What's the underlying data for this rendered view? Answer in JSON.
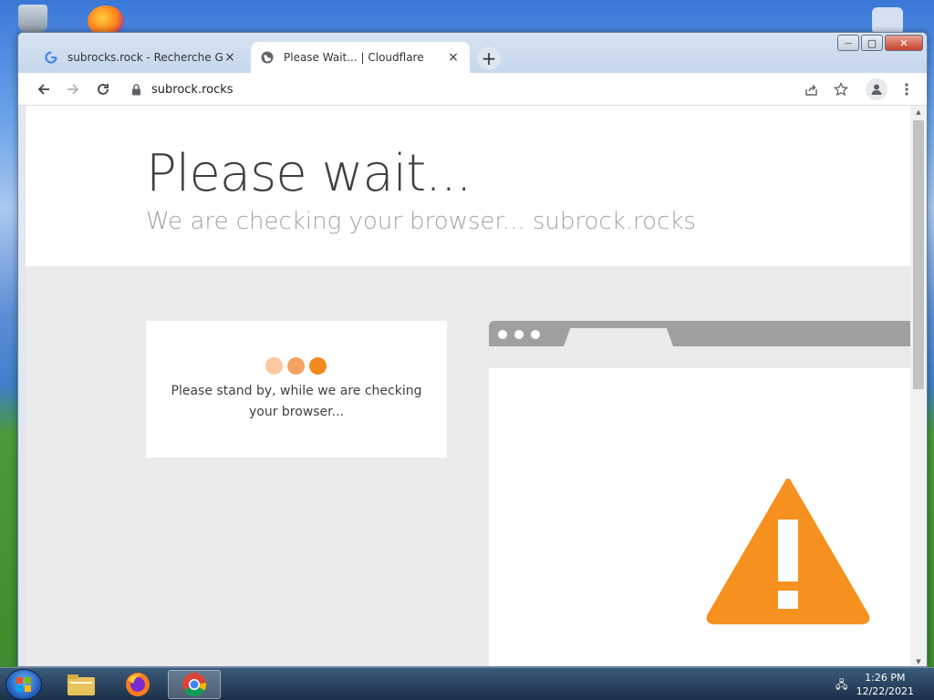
{
  "browser": {
    "tabs": [
      {
        "title": "subrocks.rock - Recherche Googl",
        "favicon": "google-icon",
        "close": "×"
      },
      {
        "title": "Please Wait... | Cloudflare",
        "favicon": "globe-icon",
        "close": "×"
      }
    ],
    "new_tab": "+",
    "address": "subrock.rocks",
    "window_controls": {
      "minimize": "—",
      "maximize": "▢",
      "close": "✕"
    }
  },
  "page": {
    "heading": "Please wait...",
    "subheading": "We are checking your browser... subrock.rocks",
    "standby_text": "Please stand by, while we are checking your browser...",
    "loader_colors": [
      "#f9c9a1",
      "#f4a261",
      "#f28a1e"
    ],
    "warning_color": "#f6901e"
  },
  "taskbar": {
    "time": "1:26 PM",
    "date": "12/22/2021",
    "apps": [
      "file-explorer-icon",
      "firefox-icon",
      "chrome-icon"
    ]
  }
}
